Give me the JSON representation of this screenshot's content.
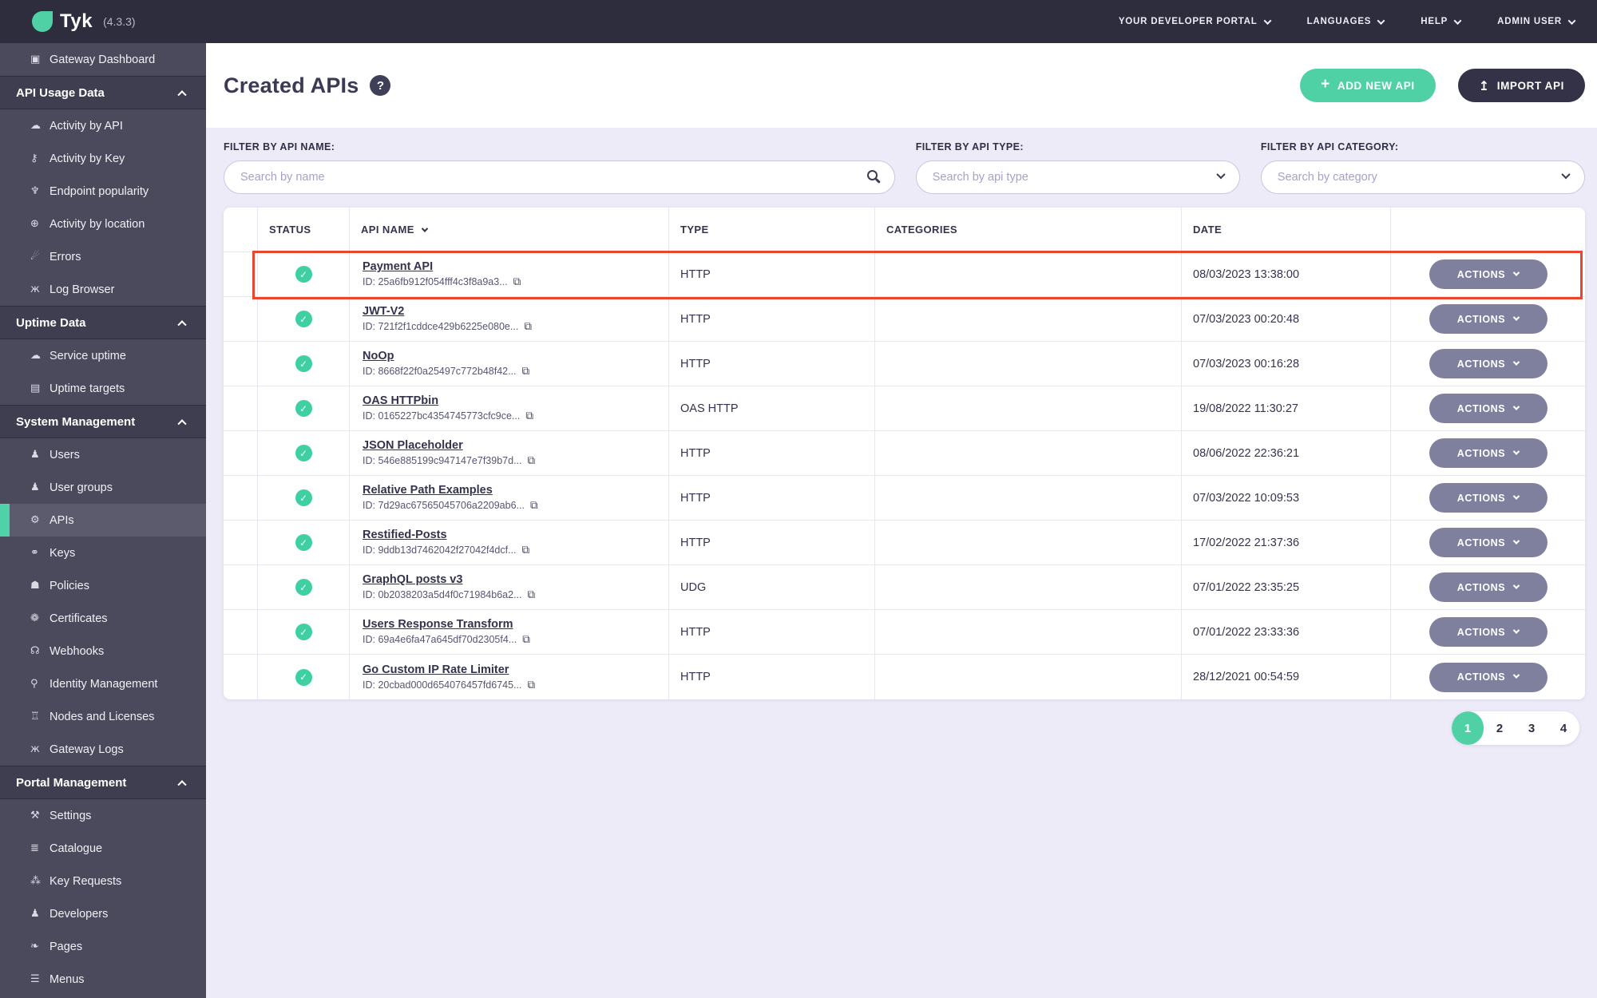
{
  "topbar": {
    "logo_text": "Tyk",
    "version": "(4.3.3)",
    "menus": [
      "YOUR DEVELOPER PORTAL",
      "LANGUAGES",
      "HELP",
      "ADMIN USER"
    ]
  },
  "sidebar": {
    "groups": [
      {
        "header": null,
        "items": [
          {
            "label": "Gateway Dashboard",
            "icon": "monitor-icon"
          }
        ]
      },
      {
        "header": "API Usage Data",
        "items": [
          {
            "label": "Activity by API",
            "icon": "cloud-activity-icon"
          },
          {
            "label": "Activity by Key",
            "icon": "key-icon"
          },
          {
            "label": "Endpoint popularity",
            "icon": "branch-icon"
          },
          {
            "label": "Activity by location",
            "icon": "globe-icon"
          },
          {
            "label": "Errors",
            "icon": "bomb-icon"
          },
          {
            "label": "Log Browser",
            "icon": "bug-icon"
          }
        ]
      },
      {
        "header": "Uptime Data",
        "items": [
          {
            "label": "Service uptime",
            "icon": "cloud-activity-icon"
          },
          {
            "label": "Uptime targets",
            "icon": "targets-list-icon"
          }
        ]
      },
      {
        "header": "System Management",
        "items": [
          {
            "label": "Users",
            "icon": "user-icon"
          },
          {
            "label": "User groups",
            "icon": "user-group-icon"
          },
          {
            "label": "APIs",
            "icon": "gears-icon",
            "active": true
          },
          {
            "label": "Keys",
            "icon": "sitemap-icon"
          },
          {
            "label": "Policies",
            "icon": "shield-icon"
          },
          {
            "label": "Certificates",
            "icon": "certificate-icon"
          },
          {
            "label": "Webhooks",
            "icon": "bell-icon"
          },
          {
            "label": "Identity Management",
            "icon": "hook-icon"
          },
          {
            "label": "Nodes and Licenses",
            "icon": "bank-icon"
          },
          {
            "label": "Gateway Logs",
            "icon": "bug-icon"
          }
        ]
      },
      {
        "header": "Portal Management",
        "items": [
          {
            "label": "Settings",
            "icon": "wrench-icon"
          },
          {
            "label": "Catalogue",
            "icon": "catalogue-icon"
          },
          {
            "label": "Key Requests",
            "icon": "paw-icon"
          },
          {
            "label": "Developers",
            "icon": "user-group-icon"
          },
          {
            "label": "Pages",
            "icon": "leaf-page-icon"
          },
          {
            "label": "Menus",
            "icon": "menu-icon"
          }
        ]
      }
    ]
  },
  "page": {
    "title": "Created APIs",
    "help_icon": "?",
    "buttons": {
      "add": "ADD NEW API",
      "import": "IMPORT API"
    }
  },
  "filters": [
    {
      "label": "FILTER BY API NAME:",
      "placeholder": "Search by name",
      "kind": "search"
    },
    {
      "label": "FILTER BY API TYPE:",
      "placeholder": "Search by api type",
      "kind": "select"
    },
    {
      "label": "FILTER BY API CATEGORY:",
      "placeholder": "Search by category",
      "kind": "select"
    }
  ],
  "table": {
    "columns": [
      "STATUS",
      "API NAME",
      "TYPE",
      "CATEGORIES",
      "DATE"
    ],
    "sort_column": "API NAME",
    "id_label": "ID:",
    "actions_label": "ACTIONS",
    "rows": [
      {
        "name": "Payment API",
        "id": "25a6fb912f054fff4c3f8a9a3...",
        "type": "HTTP",
        "category": "",
        "date": "08/03/2023 13:38:00",
        "status": "active"
      },
      {
        "name": "JWT-V2",
        "id": "721f2f1cddce429b6225e080e...",
        "type": "HTTP",
        "category": "",
        "date": "07/03/2023 00:20:48",
        "status": "active"
      },
      {
        "name": "NoOp",
        "id": "8668f22f0a25497c772b48f42...",
        "type": "HTTP",
        "category": "",
        "date": "07/03/2023 00:16:28",
        "status": "active"
      },
      {
        "name": "OAS HTTPbin",
        "id": "0165227bc4354745773cfc9ce...",
        "type": "OAS HTTP",
        "category": "",
        "date": "19/08/2022 11:30:27",
        "status": "active"
      },
      {
        "name": "JSON Placeholder",
        "id": "546e885199c947147e7f39b7d...",
        "type": "HTTP",
        "category": "",
        "date": "08/06/2022 22:36:21",
        "status": "active"
      },
      {
        "name": "Relative Path Examples",
        "id": "7d29ac67565045706a2209ab6...",
        "type": "HTTP",
        "category": "",
        "date": "07/03/2022 10:09:53",
        "status": "active"
      },
      {
        "name": "Restified-Posts",
        "id": "9ddb13d7462042f27042f4dcf...",
        "type": "HTTP",
        "category": "",
        "date": "17/02/2022 21:37:36",
        "status": "active"
      },
      {
        "name": "GraphQL posts v3",
        "id": "0b2038203a5d4f0c71984b6a2...",
        "type": "UDG",
        "category": "",
        "date": "07/01/2022 23:35:25",
        "status": "active"
      },
      {
        "name": "Users Response Transform",
        "id": "69a4e6fa47a645df70d2305f4...",
        "type": "HTTP",
        "category": "",
        "date": "07/01/2022 23:33:36",
        "status": "active"
      },
      {
        "name": "Go Custom IP Rate Limiter",
        "id": "20cbad000d654076457fd6745...",
        "type": "HTTP",
        "category": "",
        "date": "28/12/2021 00:54:59",
        "status": "active"
      }
    ],
    "highlight": {
      "row_index": 0,
      "color": "#e8472e"
    }
  },
  "pagination": {
    "pages": [
      "1",
      "2",
      "3",
      "4"
    ],
    "active": "1"
  },
  "colors": {
    "accent_teal": "#4fd1a5",
    "dark_navy": "#333247",
    "topbar_bg": "#2d2d3e",
    "sidebar_bg": "#4a4a5c",
    "filter_band_bg": "#ecebf7",
    "status_green": "#3ed0a2",
    "actions_gray": "#7f7f9e",
    "highlight_red": "#e8472e"
  }
}
